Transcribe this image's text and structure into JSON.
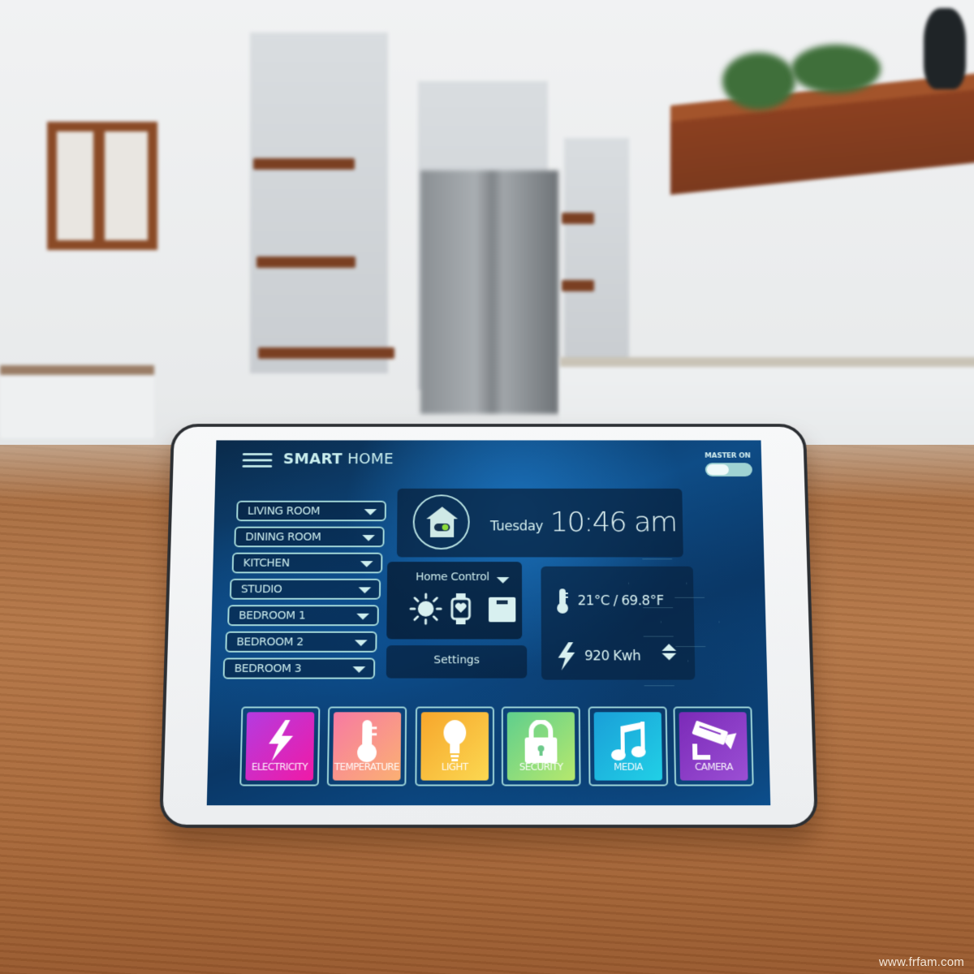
{
  "header": {
    "menu_icon": "hamburger-menu-icon",
    "title_bold": "SMART",
    "title_light": " HOME",
    "master_label": "MASTER ON",
    "master_on": true
  },
  "rooms": [
    {
      "label": "LIVING ROOM"
    },
    {
      "label": "DINING ROOM"
    },
    {
      "label": "KITCHEN"
    },
    {
      "label": "STUDIO"
    },
    {
      "label": "BEDROOM 1"
    },
    {
      "label": "BEDROOM 2"
    },
    {
      "label": "BEDROOM 3"
    }
  ],
  "clock": {
    "icon": "home-toggle-icon",
    "day": "Tuesday",
    "time": "10:46 am"
  },
  "home_control": {
    "title": "Home Control",
    "icons": [
      "sun-icon",
      "smartwatch-heart-icon",
      "scale-icon"
    ]
  },
  "settings": {
    "label": "Settings"
  },
  "stats": {
    "temperature": "21°C / 69.8°F",
    "energy": "920 Kwh"
  },
  "tiles": [
    {
      "label": "ELECTRICITY",
      "icon": "lightning-icon",
      "color_from": "#b43be0",
      "color_to": "#f01aa6"
    },
    {
      "label": "TEMPERATURE",
      "icon": "thermometer-icon",
      "color_from": "#f77aa2",
      "color_to": "#fbb073"
    },
    {
      "label": "LIGHT",
      "icon": "light-bulb-icon",
      "color_from": "#f7a62c",
      "color_to": "#fbd851"
    },
    {
      "label": "SECURITY",
      "icon": "padlock-icon",
      "color_from": "#5fcf8d",
      "color_to": "#b6e86d"
    },
    {
      "label": "MEDIA",
      "icon": "music-note-icon",
      "color_from": "#1a9fd8",
      "color_to": "#21d0e6"
    },
    {
      "label": "CAMERA",
      "icon": "security-camera-icon",
      "color_from": "#7b2ab8",
      "color_to": "#9b4fd4"
    }
  ],
  "watermark": "www.frfam.com"
}
